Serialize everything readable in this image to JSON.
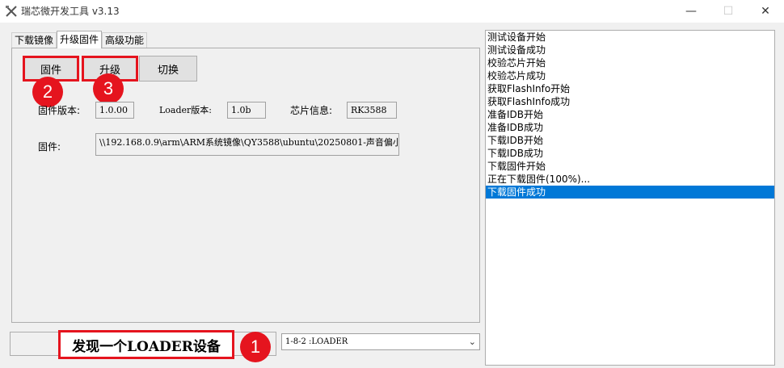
{
  "window": {
    "title": "瑞芯微开发工具 v3.13",
    "min_glyph": "—",
    "max_glyph": "☐",
    "close_glyph": "✕"
  },
  "tabs": [
    {
      "label": "下载镜像",
      "active": false
    },
    {
      "label": "升级固件",
      "active": true
    },
    {
      "label": "高级功能",
      "active": false
    }
  ],
  "buttons": {
    "firmware": "固件",
    "upgrade": "升级",
    "switch": "切换"
  },
  "info": {
    "fw_version_label": "固件版本:",
    "fw_version": "1.0.00",
    "loader_version_label": "Loader版本:",
    "loader_version": "1.0b",
    "chip_label": "芯片信息:",
    "chip": "RK3588",
    "firmware_path_label": "固件:",
    "firmware_path": "\\\\192.168.0.9\\arm\\ARM系统镜像\\QY3588\\ubuntu\\20250801-声音偏小i"
  },
  "badges": {
    "one": "1",
    "two": "2",
    "three": "3"
  },
  "log": [
    {
      "text": "测试设备开始",
      "selected": false
    },
    {
      "text": "测试设备成功",
      "selected": false
    },
    {
      "text": "校验芯片开始",
      "selected": false
    },
    {
      "text": "校验芯片成功",
      "selected": false
    },
    {
      "text": "获取FlashInfo开始",
      "selected": false
    },
    {
      "text": "获取FlashInfo成功",
      "selected": false
    },
    {
      "text": "准备IDB开始",
      "selected": false
    },
    {
      "text": "准备IDB成功",
      "selected": false
    },
    {
      "text": "下载IDB开始",
      "selected": false
    },
    {
      "text": "下载IDB成功",
      "selected": false
    },
    {
      "text": "下载固件开始",
      "selected": false
    },
    {
      "text": "正在下载固件(100%)...",
      "selected": false
    },
    {
      "text": "下载固件成功",
      "selected": true
    }
  ],
  "status": {
    "message": "发现一个LOADER设备",
    "device": "1-8-2 :LOADER"
  },
  "colors": {
    "highlight_red": "#e5141e",
    "selection_blue": "#0078d7"
  }
}
